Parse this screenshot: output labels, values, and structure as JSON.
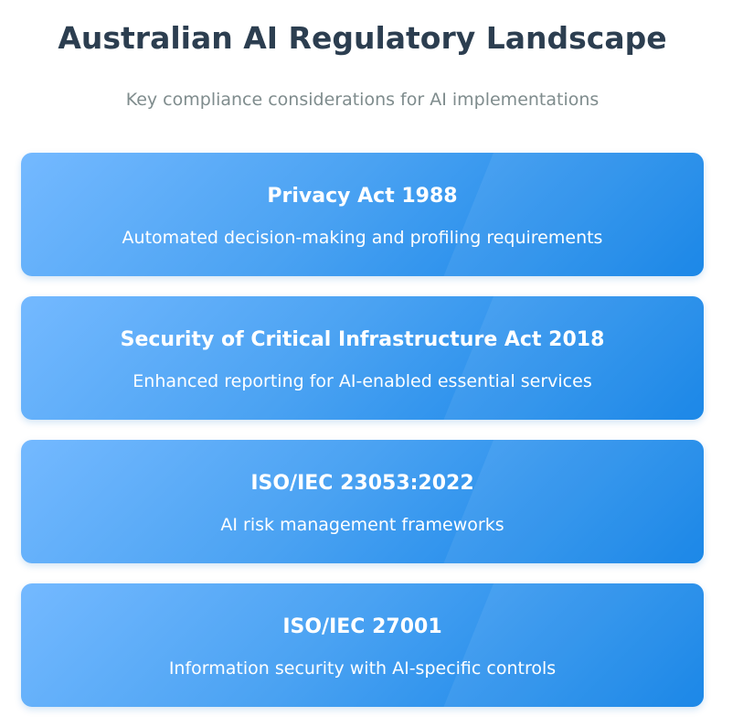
{
  "header": {
    "title": "Australian AI Regulatory Landscape",
    "subtitle": "Key compliance considerations for AI implementations"
  },
  "cards": [
    {
      "title": "Privacy Act 1988",
      "description": "Automated decision-making and profiling requirements"
    },
    {
      "title": "Security of Critical Infrastructure Act 2018",
      "description": "Enhanced reporting for AI-enabled essential services"
    },
    {
      "title": "ISO/IEC 23053:2022",
      "description": "AI risk management frameworks"
    },
    {
      "title": "ISO/IEC 27001",
      "description": "Information security with AI-specific controls"
    }
  ],
  "colors": {
    "title": "#2c3e50",
    "subtitle": "#7f8c8d",
    "card_gradient_start": "#74b9ff",
    "card_gradient_end": "#0b7fe6",
    "card_text": "#ffffff"
  }
}
